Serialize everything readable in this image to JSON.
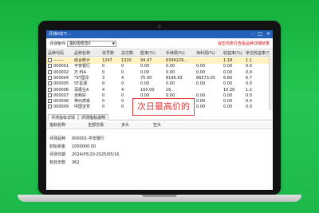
{
  "window": {
    "title": "评测K线下...",
    "controls": [
      "–",
      "□",
      "×"
    ]
  },
  "toolbar": {
    "label": "评测条件:",
    "select_value": "最K线修改X",
    "note": "双击列表行查看品种详细结果"
  },
  "grid": {
    "headers": [
      "品种代码",
      "品种名称",
      "信号数",
      "总次数",
      "胜率(%)",
      "手续费(%)",
      "净利润(%)",
      "收益率(%)",
      "单位收益率(%)"
    ],
    "rows": [
      [
        "-------",
        "综合统计",
        "1247",
        "1320",
        "94.47",
        "6399229...",
        "",
        "1.18",
        "1.1"
      ],
      [
        "000001",
        "平安银行",
        "0",
        "0",
        "0.00",
        "0.00",
        "0.00",
        "0.00",
        "0.0"
      ],
      [
        "000002",
        "万 科A",
        "0",
        "0",
        "0.00",
        "0.00",
        "0.00",
        "0.00",
        "0.0"
      ],
      [
        "000004",
        "*ST国华",
        "3",
        "4",
        "75.00",
        "8196.93",
        "66573.00",
        "6.66",
        "6.7"
      ],
      [
        "000005",
        "ST星源",
        "0",
        "0",
        "0.00",
        "0.00",
        "0.00",
        "0.00",
        "0.0"
      ],
      [
        "000006",
        "深振业A",
        "4",
        "4",
        "100.00",
        "16...",
        "",
        "10.28",
        "1.2"
      ],
      [
        "000007",
        "全新好",
        "0",
        "0",
        "0.00",
        "0.00",
        "0.00",
        "0.00",
        "0.0"
      ],
      [
        "000008",
        "神州高铁",
        "0",
        "0",
        "0.00",
        "0.00",
        "0.00",
        "0.00",
        "0.0"
      ],
      [
        "000009",
        "中国宝安",
        "0",
        "0",
        "0.00",
        "0.00",
        "0.00",
        "0.00",
        "0.0"
      ]
    ]
  },
  "lower": {
    "tabs": [
      "评测指标详情",
      "评测指标说明"
    ],
    "subheaders": [
      "指标名称",
      "全部交易",
      "多头",
      "空头"
    ],
    "items": [
      {
        "k": "评测品种",
        "v": "000001-平安银行"
      },
      {
        "k": "初始资金",
        "v": "1000000.00"
      },
      {
        "k": "评测日期",
        "v": "2024/05/20-2025/05/16"
      },
      {
        "k": "有效天数",
        "v": "362"
      }
    ]
  },
  "callout": {
    "text": "次日最高价的"
  }
}
